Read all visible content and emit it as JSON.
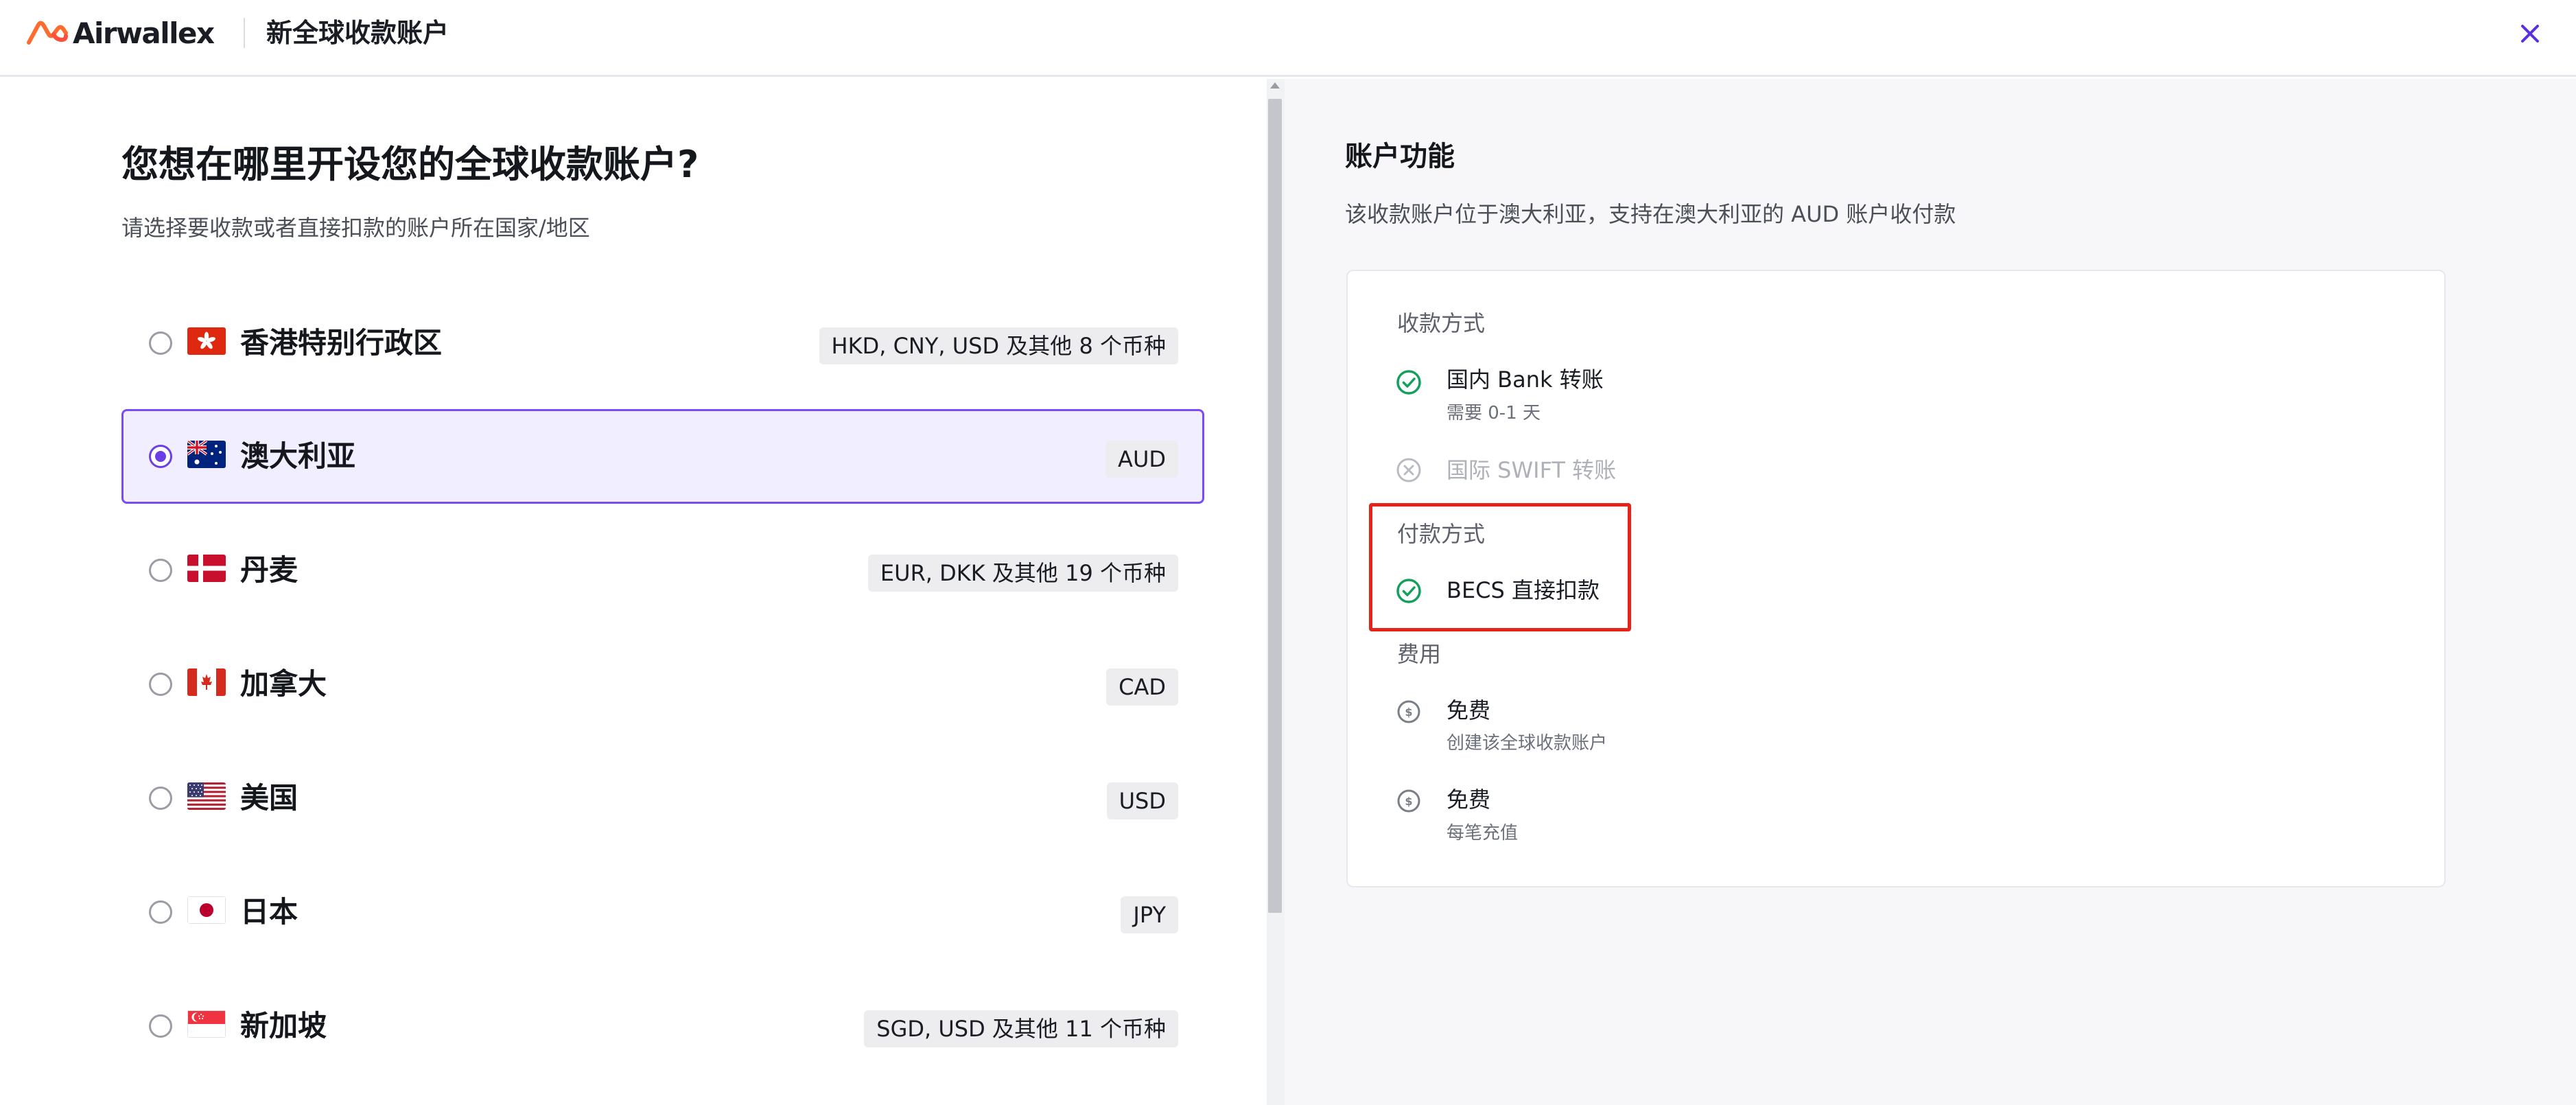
{
  "header": {
    "brand": "Airwallex",
    "title": "新全球收款账户"
  },
  "left": {
    "title": "您想在哪里开设您的全球收款账户?",
    "subtitle": "请选择要收款或者直接扣款的账户所在国家/地区",
    "countries": [
      {
        "name": "香港特别行政区",
        "currencies": "HKD, CNY, USD 及其他 8 个币种",
        "flag": "hong-kong-flag",
        "selected": false
      },
      {
        "name": "澳大利亚",
        "currencies": "AUD",
        "flag": "australia-flag",
        "selected": true
      },
      {
        "name": "丹麦",
        "currencies": "EUR, DKK 及其他 19 个币种",
        "flag": "denmark-flag",
        "selected": false
      },
      {
        "name": "加拿大",
        "currencies": "CAD",
        "flag": "canada-flag",
        "selected": false
      },
      {
        "name": "美国",
        "currencies": "USD",
        "flag": "usa-flag",
        "selected": false
      },
      {
        "name": "日本",
        "currencies": "JPY",
        "flag": "japan-flag",
        "selected": false
      },
      {
        "name": "新加坡",
        "currencies": "SGD, USD 及其他 11 个币种",
        "flag": "singapore-flag",
        "selected": false
      }
    ]
  },
  "right": {
    "title": "账户功能",
    "subtitle": "该收款账户位于澳大利亚，支持在澳大利亚的 AUD 账户收付款",
    "collection": {
      "label": "收款方式",
      "items": [
        {
          "main": "国内 Bank 转账",
          "sub": "需要 0-1 天",
          "status": "available"
        },
        {
          "main": "国际 SWIFT 转账",
          "status": "unavailable"
        }
      ]
    },
    "payment": {
      "label": "付款方式",
      "items": [
        {
          "main": "BECS 直接扣款",
          "status": "available"
        }
      ]
    },
    "fees": {
      "label": "费用",
      "items": [
        {
          "main": "免费",
          "sub": "创建该全球收款账户"
        },
        {
          "main": "免费",
          "sub": "每笔充值"
        }
      ]
    }
  },
  "colors": {
    "accent": "#6a3fe6",
    "success": "#12a05c",
    "highlight": "#e5231b",
    "brand_orange": "#ff6b2c"
  }
}
